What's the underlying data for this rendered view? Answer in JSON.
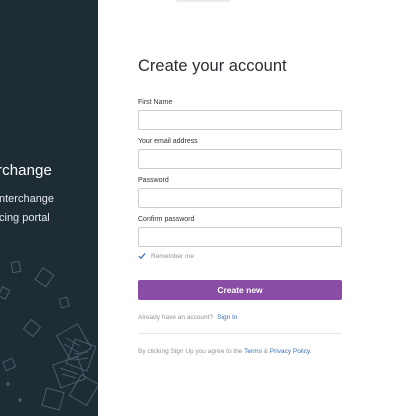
{
  "sidebar": {
    "brand": "rchange",
    "tagline_line1": "nterchange",
    "tagline_line2": "cing portal"
  },
  "form": {
    "title": "Create your account",
    "fields": [
      {
        "label": "First Name",
        "value": "",
        "placeholder": ""
      },
      {
        "label": "Your email address",
        "value": "",
        "placeholder": ""
      },
      {
        "label": "Password",
        "value": "",
        "placeholder": ""
      },
      {
        "label": "Confirm password",
        "value": "",
        "placeholder": ""
      }
    ],
    "remember_label": "Remember me",
    "remember_checked": true,
    "submit_label": "Create new",
    "have_account_text": "Already have an account?",
    "sign_in_link": "Sign In",
    "terms_prefix": "By clicking Sign Up you agree to the",
    "terms_link": "Terms",
    "terms_and": "&",
    "privacy_link": "Privacy Policy",
    "terms_suffix": "."
  },
  "colors": {
    "sidebar_bg": "#1e2c36",
    "primary_button": "#8a4da6",
    "link": "#3b6fb6"
  }
}
